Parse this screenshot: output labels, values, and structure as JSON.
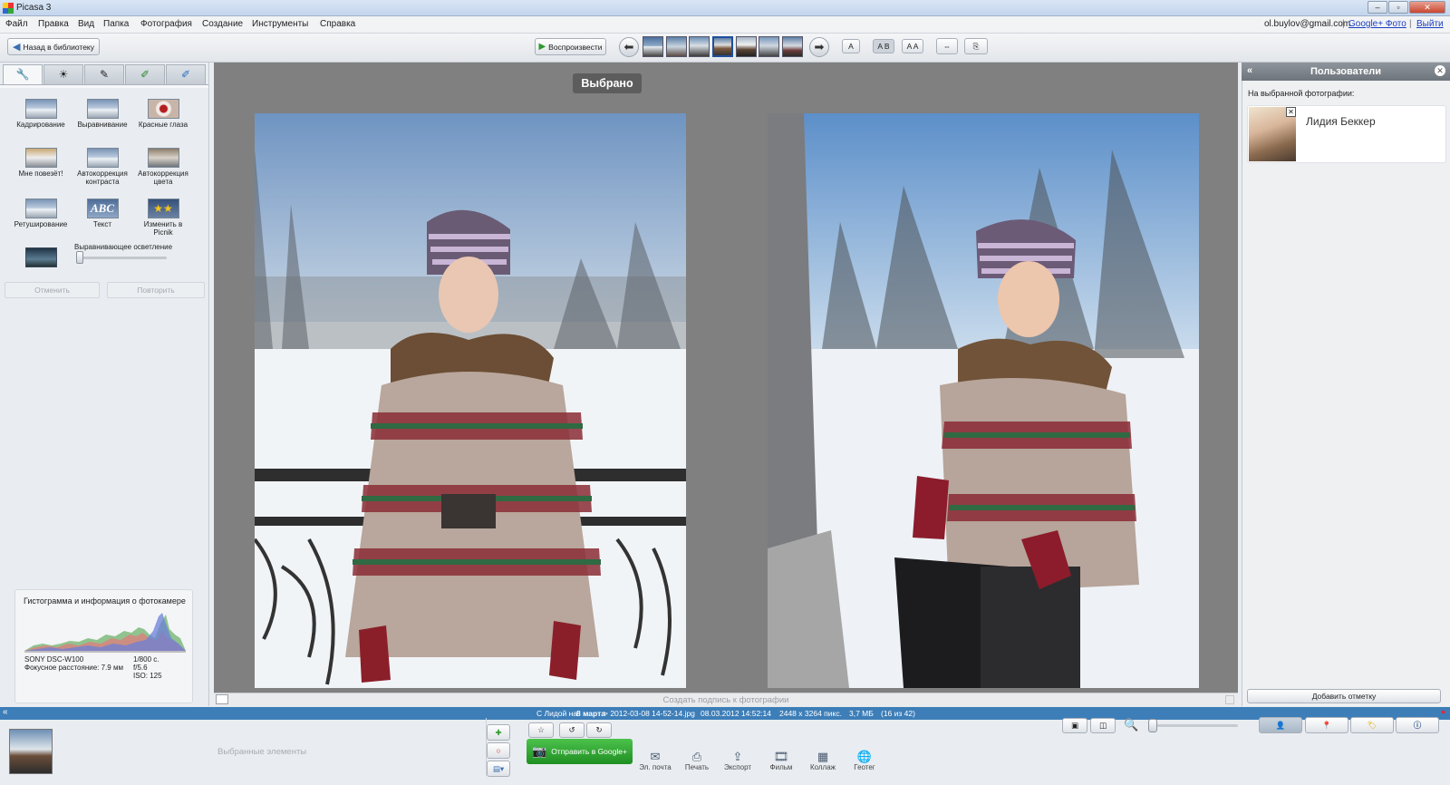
{
  "window": {
    "title": "Picasa 3",
    "min_icon": "minimize-icon",
    "max_icon": "maximize-icon",
    "close_icon": "close-icon"
  },
  "menu": {
    "items": [
      "Файл",
      "Правка",
      "Вид",
      "Папка",
      "Фотография",
      "Создание",
      "Инструменты",
      "Справка"
    ],
    "account": "ol.buylov@gmail.com",
    "sep": "|",
    "google_photos": "Google+ Фото",
    "logout": "Выйти"
  },
  "toolbar": {
    "back_label": "Назад в библиотеку",
    "play_label": "Воспроизвести",
    "caption_modes": [
      "A",
      "A B",
      "A A"
    ]
  },
  "edit_tabs": [
    "wrench-icon",
    "sun-icon",
    "brush-icon",
    "pencil-green-icon",
    "pencil-blue-icon"
  ],
  "tools": [
    {
      "label": "Кадрирование"
    },
    {
      "label": "Выравнивание"
    },
    {
      "label": "Красные глаза"
    },
    {
      "label": "Мне повезёт!"
    },
    {
      "label": "Автокоррекция контраста"
    },
    {
      "label": "Автокоррекция цвета"
    },
    {
      "label": "Ретуширование"
    },
    {
      "label": "Текст"
    },
    {
      "label": "Изменить в Picnik"
    }
  ],
  "fill_light": {
    "label": "Выравнивающее осветление",
    "value": 0
  },
  "undo_label": "Отменить",
  "redo_label": "Повторить",
  "histogram": {
    "title": "Гистограмма и информация о фотокамере",
    "camera": "SONY DSC-W100",
    "focal": "Фокусное расстояние: 7.9 мм",
    "shutter": "1/800 с.",
    "aperture": "f/5.6",
    "iso": "ISO: 125"
  },
  "center": {
    "badge": "Выбрано",
    "caption_placeholder": "Создать подпись к фотографии"
  },
  "people_panel": {
    "title": "Пользователи",
    "subtitle": "На выбранной фотографии:",
    "person": "Лидия Беккер",
    "add_tag": "Добавить отметку"
  },
  "status": {
    "prefix": "С Лидой на ",
    "date_bold": "8 марта",
    "file": " > 2012-03-08 14-52-14.jpg",
    "datetime": "08.03.2012 14:52:14",
    "dims": "2448 x 3264 пикс.",
    "size": "3,7 МБ",
    "count": "(16 из 42)"
  },
  "tray": {
    "placeholder": "Выбранные элементы",
    "share_label": "Отправить в Google+",
    "actions": [
      {
        "label": "Эл. почта",
        "icon": "email-icon"
      },
      {
        "label": "Печать",
        "icon": "print-icon"
      },
      {
        "label": "Экспорт",
        "icon": "export-icon"
      },
      {
        "label": "Фильм",
        "icon": "movie-icon"
      },
      {
        "label": "Коллаж",
        "icon": "collage-icon"
      },
      {
        "label": "Геотег",
        "icon": "geotag-icon"
      }
    ]
  }
}
